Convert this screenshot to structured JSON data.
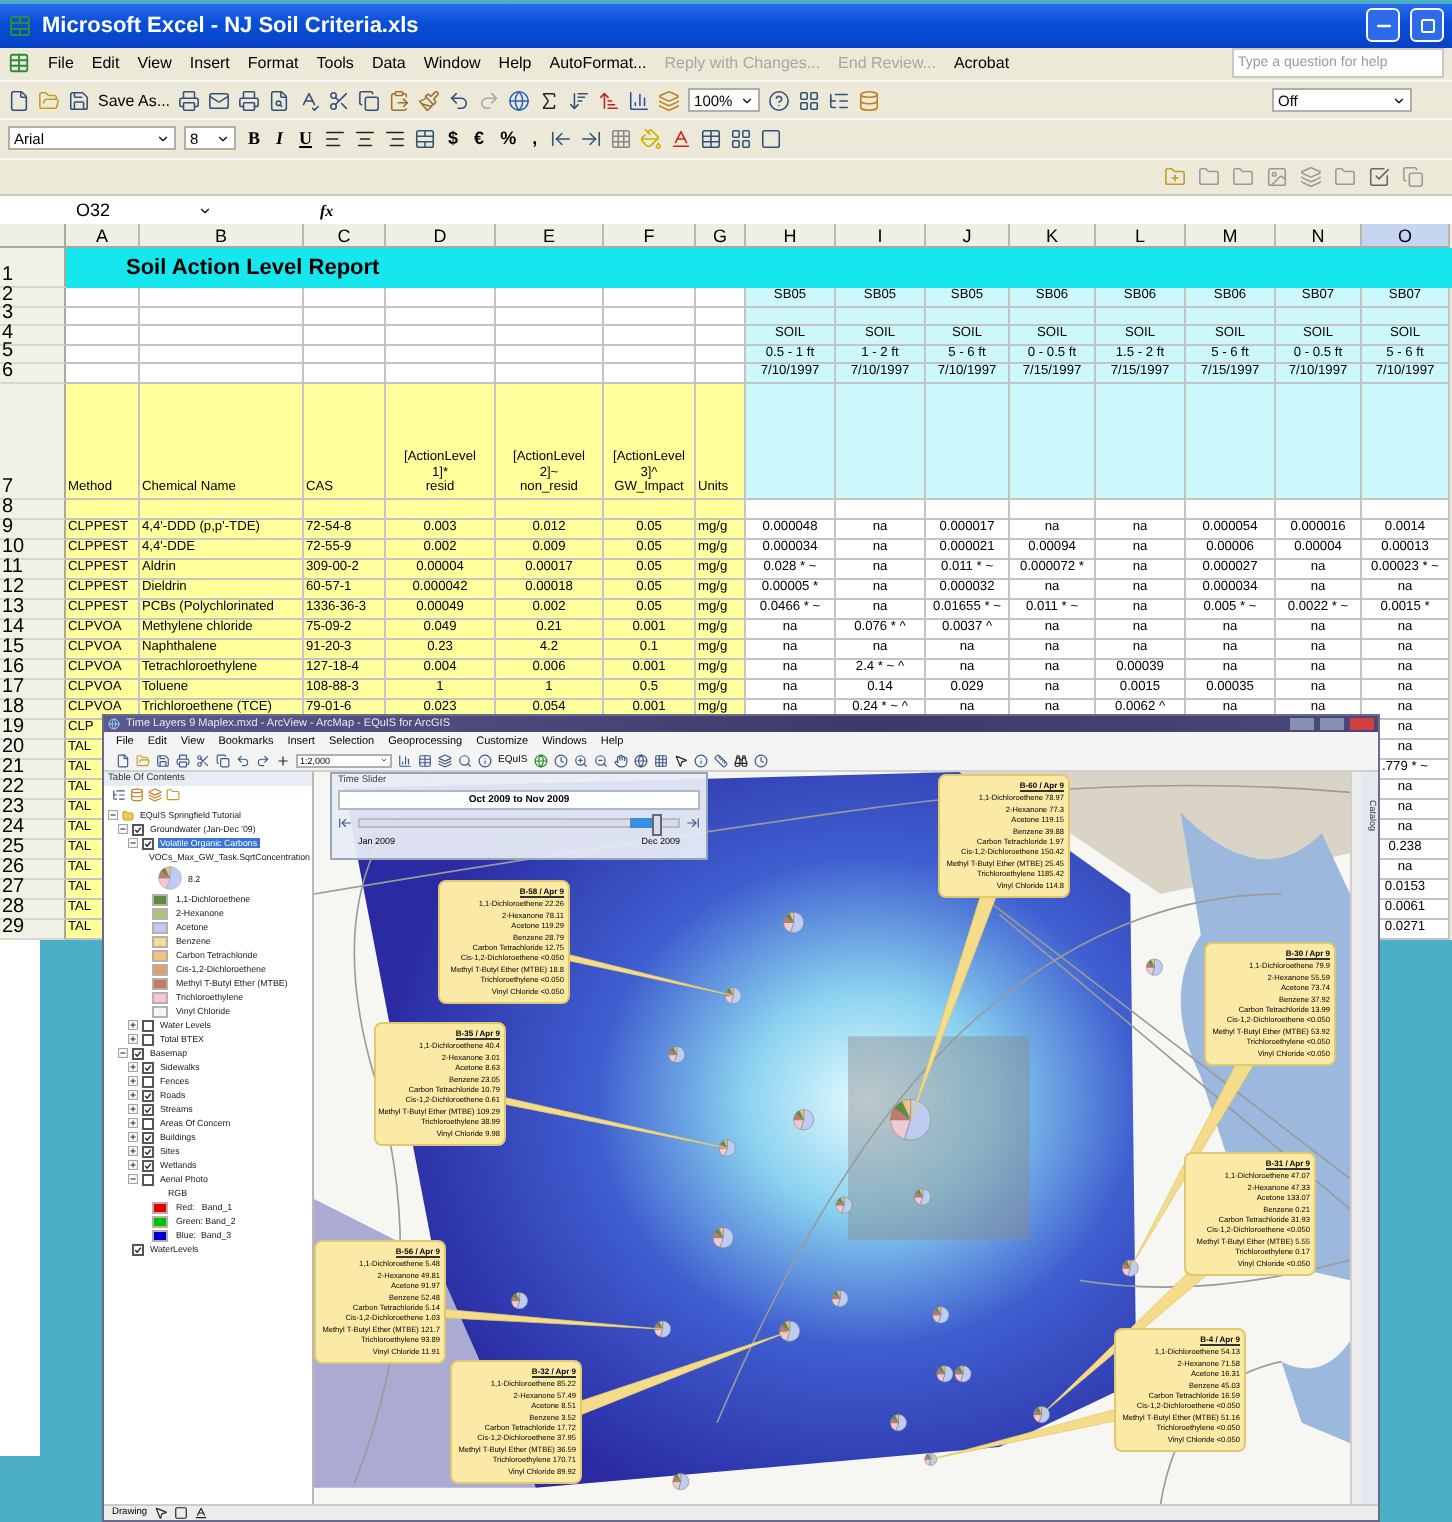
{
  "excel": {
    "title": "Microsoft Excel - NJ Soil Criteria.xls",
    "menu": [
      {
        "label": "File",
        "disabled": false
      },
      {
        "label": "Edit",
        "disabled": false
      },
      {
        "label": "View",
        "disabled": false
      },
      {
        "label": "Insert",
        "disabled": false
      },
      {
        "label": "Format",
        "disabled": false
      },
      {
        "label": "Tools",
        "disabled": false
      },
      {
        "label": "Data",
        "disabled": false
      },
      {
        "label": "Window",
        "disabled": false
      },
      {
        "label": "Help",
        "disabled": false
      },
      {
        "label": "AutoFormat...",
        "disabled": false
      },
      {
        "label": "Reply with Changes...",
        "disabled": true
      },
      {
        "label": "End Review...",
        "disabled": true
      },
      {
        "label": "Acrobat",
        "disabled": false
      }
    ],
    "help_box": {
      "placeholder": "Type a question for help"
    },
    "save_as": "Save As...",
    "zoom": "100%",
    "mode": "Off",
    "font": "Arial",
    "font_size": "8",
    "format_buttons": [
      "B",
      "I",
      "U"
    ],
    "number_buttons": [
      "$",
      "€",
      "%",
      ","
    ],
    "name_box": "O32",
    "fx": "fx",
    "columns": [
      {
        "label": "A",
        "selected": false
      },
      {
        "label": "B",
        "selected": false
      },
      {
        "label": "C",
        "selected": false
      },
      {
        "label": "D",
        "selected": false
      },
      {
        "label": "E",
        "selected": false
      },
      {
        "label": "F",
        "selected": false
      },
      {
        "label": "G",
        "selected": false
      },
      {
        "label": "H",
        "selected": false
      },
      {
        "label": "I",
        "selected": false
      },
      {
        "label": "J",
        "selected": false
      },
      {
        "label": "K",
        "selected": false
      },
      {
        "label": "L",
        "selected": false
      },
      {
        "label": "M",
        "selected": false
      },
      {
        "label": "N",
        "selected": false
      },
      {
        "label": "O",
        "selected": true
      }
    ],
    "rows": [
      {
        "number": "1",
        "kind": "title",
        "title": "Soil Action Level Report"
      },
      {
        "number": "2",
        "kind": "sample",
        "cells": [
          "SB05",
          "SB05",
          "SB05",
          "SB06",
          "SB06",
          "SB06",
          "SB07",
          "SB07"
        ]
      },
      {
        "number": "3",
        "kind": "sample",
        "cells": []
      },
      {
        "number": "4",
        "kind": "sample",
        "cells": [
          "SOIL",
          "SOIL",
          "SOIL",
          "SOIL",
          "SOIL",
          "SOIL",
          "SOIL",
          "SOIL"
        ]
      },
      {
        "number": "5",
        "kind": "sample",
        "cells": [
          "0.5 - 1 ft",
          "1 - 2 ft",
          "5 - 6 ft",
          "0 - 0.5 ft",
          "1.5 - 2 ft",
          "5 - 6 ft",
          "0 - 0.5 ft",
          "5 - 6 ft"
        ]
      },
      {
        "number": "6",
        "kind": "sample",
        "cells": [
          "7/10/1997",
          "7/10/1997",
          "7/10/1997",
          "7/15/1997",
          "7/15/1997",
          "7/15/1997",
          "7/10/1997",
          "7/10/1997"
        ]
      },
      {
        "number": "7",
        "kind": "header",
        "cells": [
          "Method",
          "Chemical Name",
          "CAS",
          "[ActionLevel\n1]*\nresid",
          "[ActionLevel\n2]~\nnon_resid",
          "[ActionLevel\n3]^\nGW_Impact",
          "Units"
        ]
      },
      {
        "number": "8",
        "kind": "blank"
      },
      {
        "number": "9",
        "kind": "data",
        "cells": [
          "CLPPEST",
          "4,4'-DDD (p,p'-TDE)",
          "72-54-8",
          "0.003",
          "0.012",
          "0.05",
          "mg/g",
          "0.000048",
          "na",
          "0.000017",
          "na",
          "na",
          "0.000054",
          "0.000016",
          "0.0014"
        ]
      },
      {
        "number": "10",
        "kind": "data",
        "cells": [
          "CLPPEST",
          "4,4'-DDE",
          "72-55-9",
          "0.002",
          "0.009",
          "0.05",
          "mg/g",
          "0.000034",
          "na",
          "0.000021",
          "0.00094",
          "na",
          "0.00006",
          "0.00004",
          "0.00013"
        ]
      },
      {
        "number": "11",
        "kind": "data",
        "cells": [
          "CLPPEST",
          "Aldrin",
          "309-00-2",
          "0.00004",
          "0.00017",
          "0.05",
          "mg/g",
          "0.028 * ~",
          "na",
          "0.011 * ~",
          "0.000072 *",
          "na",
          "0.000027",
          "na",
          "0.00023 * ~"
        ]
      },
      {
        "number": "12",
        "kind": "data",
        "cells": [
          "CLPPEST",
          "Dieldrin",
          "60-57-1",
          "0.000042",
          "0.00018",
          "0.05",
          "mg/g",
          "0.00005 *",
          "na",
          "0.000032",
          "na",
          "na",
          "0.000034",
          "na",
          "na"
        ]
      },
      {
        "number": "13",
        "kind": "data",
        "cells": [
          "CLPPEST",
          "PCBs (Polychlorinated",
          "1336-36-3",
          "0.00049",
          "0.002",
          "0.05",
          "mg/g",
          "0.0466 * ~",
          "na",
          "0.01655 * ~",
          "0.011 * ~",
          "na",
          "0.005 * ~",
          "0.0022 * ~",
          "0.0015 *"
        ]
      },
      {
        "number": "14",
        "kind": "data",
        "cells": [
          "CLPVOA",
          "Methylene chloride",
          "75-09-2",
          "0.049",
          "0.21",
          "0.001",
          "mg/g",
          "na",
          "0.076 * ^",
          "0.0037 ^",
          "na",
          "na",
          "na",
          "na",
          "na"
        ]
      },
      {
        "number": "15",
        "kind": "data",
        "cells": [
          "CLPVOA",
          "Naphthalene",
          "91-20-3",
          "0.23",
          "4.2",
          "0.1",
          "mg/g",
          "na",
          "na",
          "na",
          "na",
          "na",
          "na",
          "na",
          "na"
        ]
      },
      {
        "number": "16",
        "kind": "data",
        "cells": [
          "CLPVOA",
          "Tetrachloroethylene",
          "127-18-4",
          "0.004",
          "0.006",
          "0.001",
          "mg/g",
          "na",
          "2.4 * ~ ^",
          "na",
          "na",
          "0.00039",
          "na",
          "na",
          "na"
        ]
      },
      {
        "number": "17",
        "kind": "data",
        "cells": [
          "CLPVOA",
          "Toluene",
          "108-88-3",
          "1",
          "1",
          "0.5",
          "mg/g",
          "na",
          "0.14",
          "0.029",
          "na",
          "0.0015",
          "0.00035",
          "na",
          "na"
        ]
      },
      {
        "number": "18",
        "kind": "data",
        "cells": [
          "CLPVOA",
          "Trichloroethene (TCE)",
          "79-01-6",
          "0.023",
          "0.054",
          "0.001",
          "mg/g",
          "na",
          "0.24 * ~ ^",
          "na",
          "na",
          "0.0062 ^",
          "na",
          "na",
          "na"
        ]
      },
      {
        "number": "19",
        "kind": "partial",
        "first": "CLP",
        "last": "na"
      },
      {
        "number": "20",
        "kind": "partial",
        "first": "TAL",
        "last": "na"
      },
      {
        "number": "21",
        "kind": "partial",
        "first": "TAL",
        "last": ".779 * ~"
      },
      {
        "number": "22",
        "kind": "partial",
        "first": "TAL",
        "last": "na"
      },
      {
        "number": "23",
        "kind": "partial",
        "first": "TAL",
        "last": "na"
      },
      {
        "number": "24",
        "kind": "partial",
        "first": "TAL",
        "last": "na"
      },
      {
        "number": "25",
        "kind": "partial",
        "first": "TAL",
        "last": "0.238"
      },
      {
        "number": "26",
        "kind": "partial",
        "first": "TAL",
        "last": "na"
      },
      {
        "number": "27",
        "kind": "partial",
        "first": "TAL",
        "last": "0.0153"
      },
      {
        "number": "28",
        "kind": "partial",
        "first": "TAL",
        "last": "0.0061"
      },
      {
        "number": "29",
        "kind": "partial",
        "first": "TAL",
        "last": "0.0271"
      }
    ]
  },
  "arcmap": {
    "title": "Time Layers 9 Maplex.mxd - ArcView - ArcMap - EQuIS for ArcGIS",
    "menu": [
      "File",
      "Edit",
      "View",
      "Bookmarks",
      "Insert",
      "Selection",
      "Geoprocessing",
      "Customize",
      "Windows",
      "Help"
    ],
    "scale": "1:2,000",
    "toolbar_label": "EQuIS",
    "toc": {
      "title": "Table Of Contents",
      "tree": [
        {
          "kind": "frame",
          "label": "EQuIS Springfield Tutorial",
          "expanded": true,
          "children": [
            {
              "kind": "layer",
              "label": "Groundwater (Jan-Dec '09)",
              "checked": true,
              "selected": false,
              "expanded": true,
              "children": [
                {
                  "kind": "layer",
                  "label": "Volatile Organic Carbons",
                  "checked": true,
                  "selected": true,
                  "expanded": true,
                  "children": [
                    {
                      "kind": "field",
                      "label": "VOCs_Max_GW_Task.SqrtConcentration"
                    },
                    {
                      "kind": "pie",
                      "label": "8.2"
                    },
                    {
                      "kind": "legend",
                      "label": "1,1-Dichloroethene",
                      "color": "#5e8c3c"
                    },
                    {
                      "kind": "legend",
                      "label": "2-Hexanone",
                      "color": "#a9c77a"
                    },
                    {
                      "kind": "legend",
                      "label": "Acetone",
                      "color": "#bcccf2"
                    },
                    {
                      "kind": "legend",
                      "label": "Benzene",
                      "color": "#f2dc96"
                    },
                    {
                      "kind": "legend",
                      "label": "Carbon Tetrachloride",
                      "color": "#f0c47a"
                    },
                    {
                      "kind": "legend",
                      "label": "Cis-1,2-Dichloroethene",
                      "color": "#d9a06e"
                    },
                    {
                      "kind": "legend",
                      "label": "Methyl T-Butyl Ether (MTBE)",
                      "color": "#c27a62"
                    },
                    {
                      "kind": "legend",
                      "label": "Trichloroethylene",
                      "color": "#f2c8d2"
                    },
                    {
                      "kind": "legend",
                      "label": "Vinyl Chloride",
                      "color": "#faf4f4"
                    }
                  ]
                },
                {
                  "kind": "layer",
                  "label": "Water Levels",
                  "checked": false,
                  "selected": false,
                  "expanded": false
                },
                {
                  "kind": "layer",
                  "label": "Total BTEX",
                  "checked": false,
                  "selected": false,
                  "expanded": false
                }
              ]
            },
            {
              "kind": "layer",
              "label": "Basemap",
              "checked": true,
              "selected": false,
              "expanded": true,
              "children": [
                {
                  "kind": "layer",
                  "label": "Sidewalks",
                  "checked": true,
                  "selected": false,
                  "expanded": false
                },
                {
                  "kind": "layer",
                  "label": "Fences",
                  "checked": false,
                  "selected": false,
                  "expanded": false
                },
                {
                  "kind": "layer",
                  "label": "Roads",
                  "checked": true,
                  "selected": false,
                  "expanded": false
                },
                {
                  "kind": "layer",
                  "label": "Streams",
                  "checked": true,
                  "selected": false,
                  "expanded": false
                },
                {
                  "kind": "layer",
                  "label": "Areas Of Concern",
                  "checked": false,
                  "selected": false,
                  "expanded": false
                },
                {
                  "kind": "layer",
                  "label": "Buildings",
                  "checked": true,
                  "selected": false,
                  "expanded": false
                },
                {
                  "kind": "layer",
                  "label": "Sites",
                  "checked": true,
                  "selected": false,
                  "expanded": false
                },
                {
                  "kind": "layer",
                  "label": "Wetlands",
                  "checked": true,
                  "selected": false,
                  "expanded": false
                },
                {
                  "kind": "layer",
                  "label": "Aerial Photo",
                  "checked": false,
                  "selected": false,
                  "expanded": true,
                  "children": [
                    {
                      "kind": "field",
                      "label": "RGB"
                    },
                    {
                      "kind": "legend",
                      "label": "Red:   Band_1",
                      "color": "#e00000"
                    },
                    {
                      "kind": "legend",
                      "label": "Green: Band_2",
                      "color": "#00c000"
                    },
                    {
                      "kind": "legend",
                      "label": "Blue:  Band_3",
                      "color": "#0000c8"
                    }
                  ]
                }
              ]
            },
            {
              "kind": "layer",
              "label": "WaterLevels",
              "checked": true,
              "selected": false
            }
          ]
        }
      ]
    },
    "time_slider": {
      "title": "Time Slider",
      "range": "Oct 2009 to Nov 2009",
      "start": "Jan 2009",
      "end": "Dec 2009",
      "level": 0.93
    },
    "callouts": [
      {
        "title": "B-58 / Apr 9",
        "lines": [
          "1,1-Dichloroethene 22.26",
          "2-Hexanone 78.11",
          "Acetone 119.29",
          "Benzene 28.79",
          "Carbon Tetrachloride 12.75",
          "Cis-1,2-Dichloroethene <0.050",
          "Methyl T-Butyl Ether (MTBE) 18.8",
          "Trichloroethylene <0.050",
          "Vinyl Chloride <0.050"
        ]
      },
      {
        "title": "B-35 / Apr 9",
        "lines": [
          "1,1-Dichloroethene 40.4",
          "2-Hexanone 3.01",
          "Acetone 8.63",
          "Benzene 23.05",
          "Carbon Tetrachloride 10.79",
          "Cis-1,2-Dichloroethene 0.61",
          "Methyl T-Butyl Ether (MTBE) 109.29",
          "Trichloroethylene 38.99",
          "Vinyl Chloride 9.98"
        ]
      },
      {
        "title": "B-56 / Apr 9",
        "lines": [
          "1,1-Dichloroethene 5.48",
          "2-Hexanone 49.81",
          "Acetone 91.97",
          "Benzene 52.48",
          "Carbon Tetrachloride 5.14",
          "Cis-1,2-Dichloroethene 1.03",
          "Methyl T-Butyl Ether (MTBE) 121.7",
          "Trichloroethylene 93.89",
          "Vinyl Chloride 11.91"
        ]
      },
      {
        "title": "B-32 / Apr 9",
        "lines": [
          "1,1-Dichloroethene 85.22",
          "2-Hexanone 57.49",
          "Acetone 8.51",
          "Benzene 3.52",
          "Carbon Tetrachloride 17.72",
          "Cis-1,2-Dichloroethene 37.95",
          "Methyl T-Butyl Ether (MTBE) 36.59",
          "Trichloroethylene 170.71",
          "Vinyl Chloride 89.92"
        ]
      },
      {
        "title": "B-60 / Apr 9",
        "lines": [
          "1,1-Dichloroethene 78.97",
          "2-Hexanone 77.3",
          "Acetone 119.15",
          "Benzene 39.88",
          "Carbon Tetrachloride 1.97",
          "Cis-1,2-Dichloroethene 150.42",
          "Methyl T-Butyl Ether (MTBE) 25.45",
          "Trichloroethylene 1185.42",
          "Vinyl Chloride 114.8"
        ]
      },
      {
        "title": "B-30 / Apr 9",
        "lines": [
          "1,1-Dichloroethene 79.9",
          "2-Hexanone 55.59",
          "Acetone 73.74",
          "Benzene 37.92",
          "Carbon Tetrachloride 13.99",
          "Cis-1,2-Dichloroethene <0.050",
          "Methyl T-Butyl Ether (MTBE) 53.92",
          "Trichloroethylene <0.050",
          "Vinyl Chloride <0.050"
        ]
      },
      {
        "title": "B-31 / Apr 9",
        "lines": [
          "1,1-Dichloroethene 47.07",
          "2-Hexanone 47.33",
          "Acetone 133.07",
          "Benzene 0.21",
          "Carbon Tetrachloride 31.93",
          "Cis-1,2-Dichloroethene <0.050",
          "Methyl T-Butyl Ether (MTBE) 5.55",
          "Trichloroethylene 0.17",
          "Vinyl Chloride <0.050"
        ]
      },
      {
        "title": "B-4 / Apr 9",
        "lines": [
          "1,1-Dichloroethene 54.13",
          "2-Hexanone 71.58",
          "Acetone 16.31",
          "Benzene 45.03",
          "Carbon Tetrachloride 16.59",
          "Cis-1,2-Dichloroethene <0.050",
          "Methyl T-Butyl Ether (MTBE) 51.16",
          "Trichloroethylene <0.050",
          "Vinyl Chloride <0.050"
        ]
      }
    ],
    "side_tab": "Catalog",
    "status": "Drawing"
  }
}
